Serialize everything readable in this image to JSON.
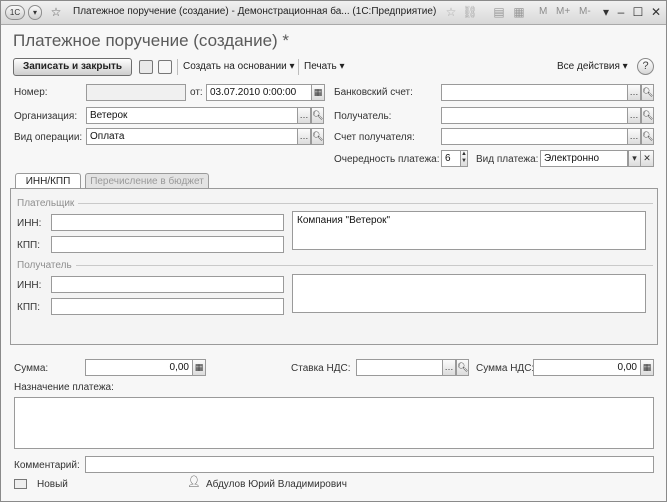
{
  "titlebar": {
    "menu_icon": "1C",
    "title": "Платежное поручение (создание) - Демонстрационная ба... (1С:Предприятие)",
    "memory_buttons": [
      "M",
      "M+",
      "M-"
    ]
  },
  "form": {
    "title": "Платежное поручение (создание) *"
  },
  "toolbar": {
    "save_close": "Записать и закрыть",
    "create_based": "Создать на основании",
    "print": "Печать",
    "all_actions": "Все действия",
    "help": "?"
  },
  "fields": {
    "number_label": "Номер:",
    "number_value": "",
    "date_label": "от:",
    "date_value": "03.07.2010  0:00:00",
    "bank_account_label": "Банковский счет:",
    "bank_account_value": "",
    "org_label": "Организация:",
    "org_value": "Ветерок",
    "recipient_label": "Получатель:",
    "recipient_value": "",
    "op_type_label": "Вид операции:",
    "op_type_value": "Оплата",
    "recipient_account_label": "Счет получателя:",
    "recipient_account_value": "",
    "priority_label": "Очередность платежа:",
    "priority_value": "6",
    "payment_type_label": "Вид платежа:",
    "payment_type_value": "Электронно"
  },
  "tabs": [
    {
      "label": "ИНН/КПП",
      "active": true
    },
    {
      "label": "Перечисление в бюджет",
      "active": false
    }
  ],
  "payer": {
    "group_label": "Плательщик",
    "inn_label": "ИНН:",
    "inn_value": "",
    "kpp_label": "КПП:",
    "kpp_value": "",
    "name_value": "Компания \"Ветерок\""
  },
  "recipient": {
    "group_label": "Получатель",
    "inn_label": "ИНН:",
    "inn_value": "",
    "kpp_label": "КПП:",
    "kpp_value": "",
    "name_value": ""
  },
  "amounts": {
    "sum_label": "Сумма:",
    "sum_value": "0,00",
    "vat_rate_label": "Ставка НДС:",
    "vat_rate_value": "",
    "vat_sum_label": "Сумма НДС:",
    "vat_sum_value": "0,00"
  },
  "purpose": {
    "label": "Назначение платежа:",
    "value": ""
  },
  "comment": {
    "label": "Комментарий:",
    "value": ""
  },
  "status": {
    "state": "Новый",
    "user": "Абдулов Юрий Владимирович"
  }
}
